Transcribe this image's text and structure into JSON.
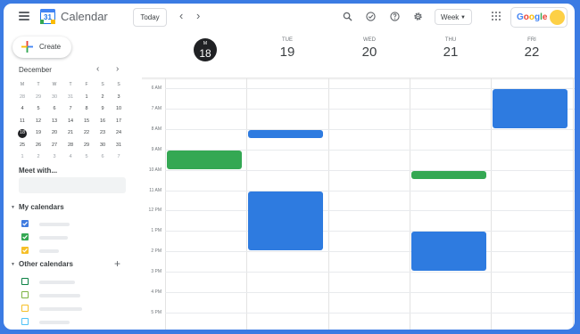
{
  "app": {
    "title": "Calendar",
    "logo_day": "31"
  },
  "header": {
    "today_label": "Today",
    "view_label": "Week",
    "brand": "Google",
    "brand_colors": [
      "#4285f4",
      "#ea4335",
      "#fbbc04",
      "#4285f4",
      "#34a853",
      "#ea4335"
    ],
    "icons": [
      "menu-icon",
      "chevron-left-icon",
      "chevron-right-icon",
      "search-icon",
      "status-icon",
      "help-icon",
      "settings-icon",
      "apps-icon"
    ]
  },
  "sidebar": {
    "create_label": "Create",
    "mini_calendar": {
      "month": "December",
      "weekdays": [
        "M",
        "T",
        "W",
        "T",
        "F",
        "S",
        "S"
      ],
      "weeks": [
        [
          "28",
          "29",
          "30",
          "31",
          "1",
          "2",
          "3"
        ],
        [
          "4",
          "5",
          "6",
          "7",
          "8",
          "9",
          "10"
        ],
        [
          "11",
          "12",
          "13",
          "14",
          "15",
          "16",
          "17"
        ],
        [
          "18",
          "19",
          "20",
          "21",
          "22",
          "23",
          "24"
        ],
        [
          "25",
          "26",
          "27",
          "28",
          "29",
          "30",
          "31"
        ],
        [
          "1",
          "2",
          "3",
          "4",
          "5",
          "6",
          "7"
        ]
      ],
      "selected": "18"
    },
    "meet_with_label": "Meet with...",
    "my_calendars_label": "My calendars",
    "my_calendars": [
      {
        "color": "#3f7be0",
        "checked": true
      },
      {
        "color": "#34a853",
        "checked": true
      },
      {
        "color": "#f6bf26",
        "checked": true
      }
    ],
    "other_calendars_label": "Other calendars",
    "other_calendars": [
      {
        "color": "#0b8043",
        "checked": false
      },
      {
        "color": "#7cb342",
        "checked": false
      },
      {
        "color": "#f6bf26",
        "checked": false
      },
      {
        "color": "#4fc3f7",
        "checked": false
      }
    ]
  },
  "week": {
    "days": [
      {
        "name": "M",
        "date": "18",
        "today": true
      },
      {
        "name": "TUE",
        "date": "19"
      },
      {
        "name": "WED",
        "date": "20"
      },
      {
        "name": "THU",
        "date": "21"
      },
      {
        "name": "FRI",
        "date": "22"
      }
    ],
    "hours": [
      "6 AM",
      "7 AM",
      "8 AM",
      "9 AM",
      "10 AM",
      "11 AM",
      "12 PM",
      "1 PM",
      "2 PM",
      "3 PM",
      "4 PM",
      "5 PM"
    ],
    "events": [
      {
        "day": 0,
        "start": "9:00",
        "end": "10:00",
        "color": "#34a853"
      },
      {
        "day": 1,
        "start": "8:00",
        "end": "8:30",
        "color": "#2e7be0"
      },
      {
        "day": 1,
        "start": "11:00",
        "end": "2:00 PM",
        "color": "#2e7be0"
      },
      {
        "day": 3,
        "start": "10:00",
        "end": "10:30",
        "color": "#34a853"
      },
      {
        "day": 3,
        "start": "1:00 PM",
        "end": "3:00 PM",
        "color": "#2e7be0"
      },
      {
        "day": 4,
        "start": "6:00",
        "end": "8:00",
        "color": "#2e7be0"
      }
    ]
  }
}
